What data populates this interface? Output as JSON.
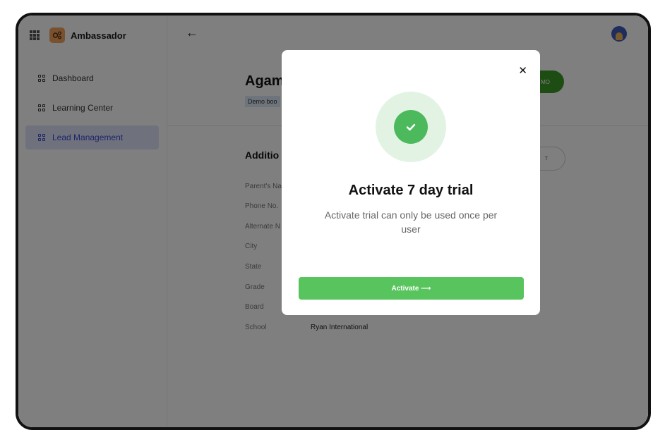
{
  "sidebar": {
    "brand_name": "Ambassador",
    "items": [
      {
        "label": "Dashboard"
      },
      {
        "label": "Learning Center"
      },
      {
        "label": "Lead Management"
      }
    ]
  },
  "header": {
    "back_icon": "arrow-left-icon",
    "avatar_icon": "user-avatar"
  },
  "page": {
    "title": "Agam",
    "tag": "Demo boo",
    "demo_button_label": "MO",
    "section_title": "Additio",
    "edit_button_label": "T",
    "fields": [
      {
        "label": "Parent's Na",
        "value": ""
      },
      {
        "label": "Phone No.",
        "value": ""
      },
      {
        "label": "Alternate N",
        "value": ""
      },
      {
        "label": "City",
        "value": ""
      },
      {
        "label": "State",
        "value": ""
      },
      {
        "label": "Grade",
        "value": ""
      },
      {
        "label": "Board",
        "value": ""
      },
      {
        "label": "School",
        "value": "Ryan International"
      }
    ]
  },
  "modal": {
    "close_icon": "close-icon",
    "success_icon": "check-circle-icon",
    "title": "Activate 7 day trial",
    "description": "Activate trial can only be used once per user",
    "button_label": "Activate ⟶"
  },
  "colors": {
    "accent_green": "#58c45d",
    "active_nav_bg": "#dfe2fb",
    "active_nav_text": "#3b4bd0",
    "brand_orange": "#f5a35c"
  }
}
